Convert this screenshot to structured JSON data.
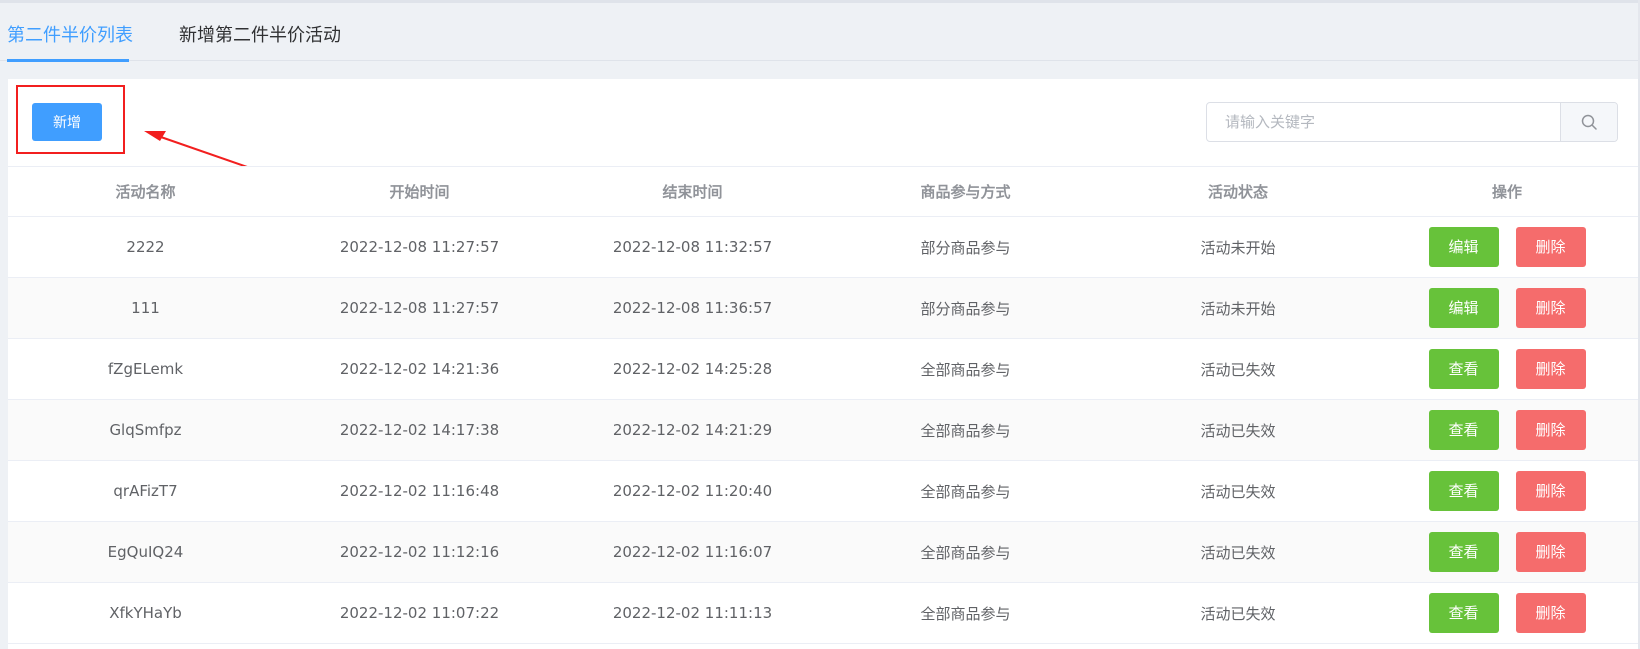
{
  "tabs": [
    {
      "label": "第二件半价列表",
      "active": true
    },
    {
      "label": "新增第二件半价活动",
      "active": false
    }
  ],
  "toolbar": {
    "add_label": "新增"
  },
  "search": {
    "placeholder": "请输入关键字",
    "value": ""
  },
  "table": {
    "headers": [
      "活动名称",
      "开始时间",
      "结束时间",
      "商品参与方式",
      "活动状态",
      "操作"
    ],
    "rows": [
      {
        "name": "2222",
        "start": "2022-12-08 11:27:57",
        "end": "2022-12-08 11:32:57",
        "mode": "部分商品参与",
        "status": "活动未开始",
        "primary_action": "编辑",
        "delete_action": "删除"
      },
      {
        "name": "111",
        "start": "2022-12-08 11:27:57",
        "end": "2022-12-08 11:36:57",
        "mode": "部分商品参与",
        "status": "活动未开始",
        "primary_action": "编辑",
        "delete_action": "删除"
      },
      {
        "name": "fZgELemk",
        "start": "2022-12-02 14:21:36",
        "end": "2022-12-02 14:25:28",
        "mode": "全部商品参与",
        "status": "活动已失效",
        "primary_action": "查看",
        "delete_action": "删除"
      },
      {
        "name": "GlqSmfpz",
        "start": "2022-12-02 14:17:38",
        "end": "2022-12-02 14:21:29",
        "mode": "全部商品参与",
        "status": "活动已失效",
        "primary_action": "查看",
        "delete_action": "删除"
      },
      {
        "name": "qrAFizT7",
        "start": "2022-12-02 11:16:48",
        "end": "2022-12-02 11:20:40",
        "mode": "全部商品参与",
        "status": "活动已失效",
        "primary_action": "查看",
        "delete_action": "删除"
      },
      {
        "name": "EgQuIQ24",
        "start": "2022-12-02 11:12:16",
        "end": "2022-12-02 11:16:07",
        "mode": "全部商品参与",
        "status": "活动已失效",
        "primary_action": "查看",
        "delete_action": "删除"
      },
      {
        "name": "XfkYHaYb",
        "start": "2022-12-02 11:07:22",
        "end": "2022-12-02 11:11:13",
        "mode": "全部商品参与",
        "status": "活动已失效",
        "primary_action": "查看",
        "delete_action": "删除"
      }
    ]
  },
  "colors": {
    "primary": "#409eff",
    "success": "#67c23a",
    "danger": "#f56c6c",
    "annotation": "#f21f1f"
  },
  "icons": {
    "search": "search-icon"
  }
}
